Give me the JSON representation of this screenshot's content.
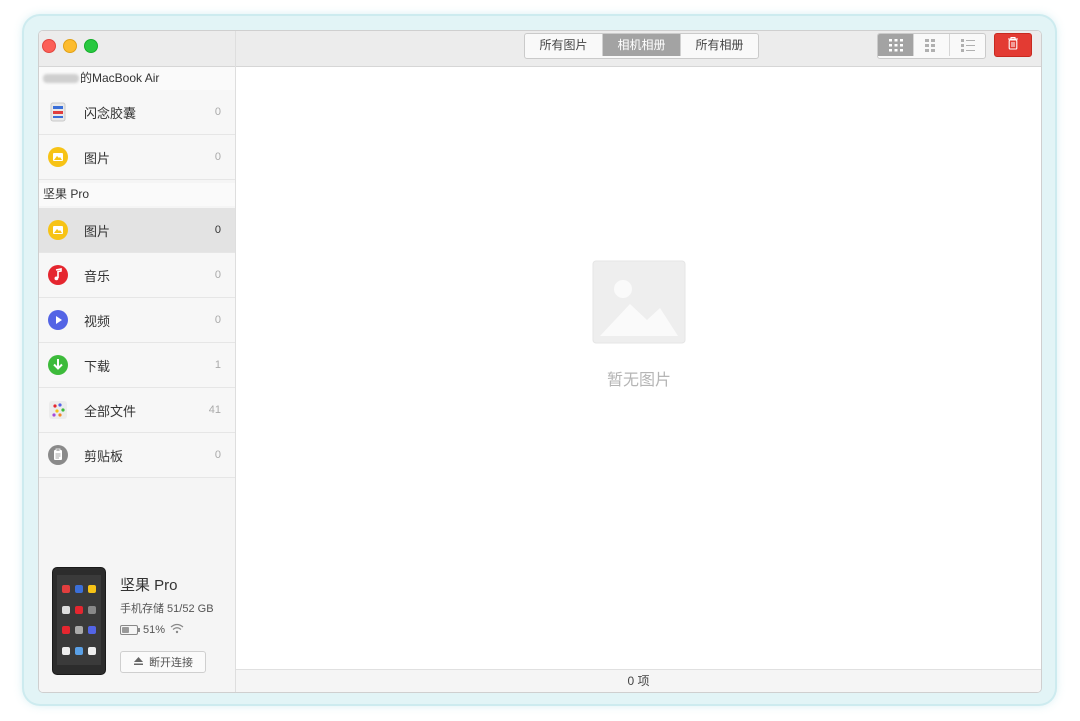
{
  "window": {
    "tabs": [
      {
        "label": "所有图片",
        "active": false
      },
      {
        "label": "相机相册",
        "active": true
      },
      {
        "label": "所有相册",
        "active": false
      }
    ],
    "view_modes": [
      "large-grid-icon",
      "medium-grid-icon",
      "list-grid-icon"
    ],
    "active_view_mode": 0,
    "accent_delete": "#e33b33"
  },
  "sidebar": {
    "section_mac": {
      "title": "的MacBook Air"
    },
    "mac_items": [
      {
        "label": "闪念胶囊",
        "count": "0",
        "icon": "flash-capsule-icon"
      },
      {
        "label": "图片",
        "count": "0",
        "icon": "photos-icon"
      }
    ],
    "section_phone": {
      "title": "坚果 Pro"
    },
    "phone_items": [
      {
        "label": "图片",
        "count": "0",
        "icon": "photos-icon",
        "selected": true
      },
      {
        "label": "音乐",
        "count": "0",
        "icon": "music-icon"
      },
      {
        "label": "视频",
        "count": "0",
        "icon": "video-icon"
      },
      {
        "label": "下载",
        "count": "1",
        "icon": "download-icon"
      },
      {
        "label": "全部文件",
        "count": "41",
        "icon": "all-files-icon"
      },
      {
        "label": "剪贴板",
        "count": "0",
        "icon": "clipboard-icon"
      }
    ],
    "device": {
      "name": "坚果 Pro",
      "storage": "手机存储 51/52 GB",
      "battery": "51%",
      "battery_level": 0.51,
      "disconnect_label": "断开连接"
    }
  },
  "main": {
    "empty_text": "暂无图片",
    "status": "0 项"
  }
}
